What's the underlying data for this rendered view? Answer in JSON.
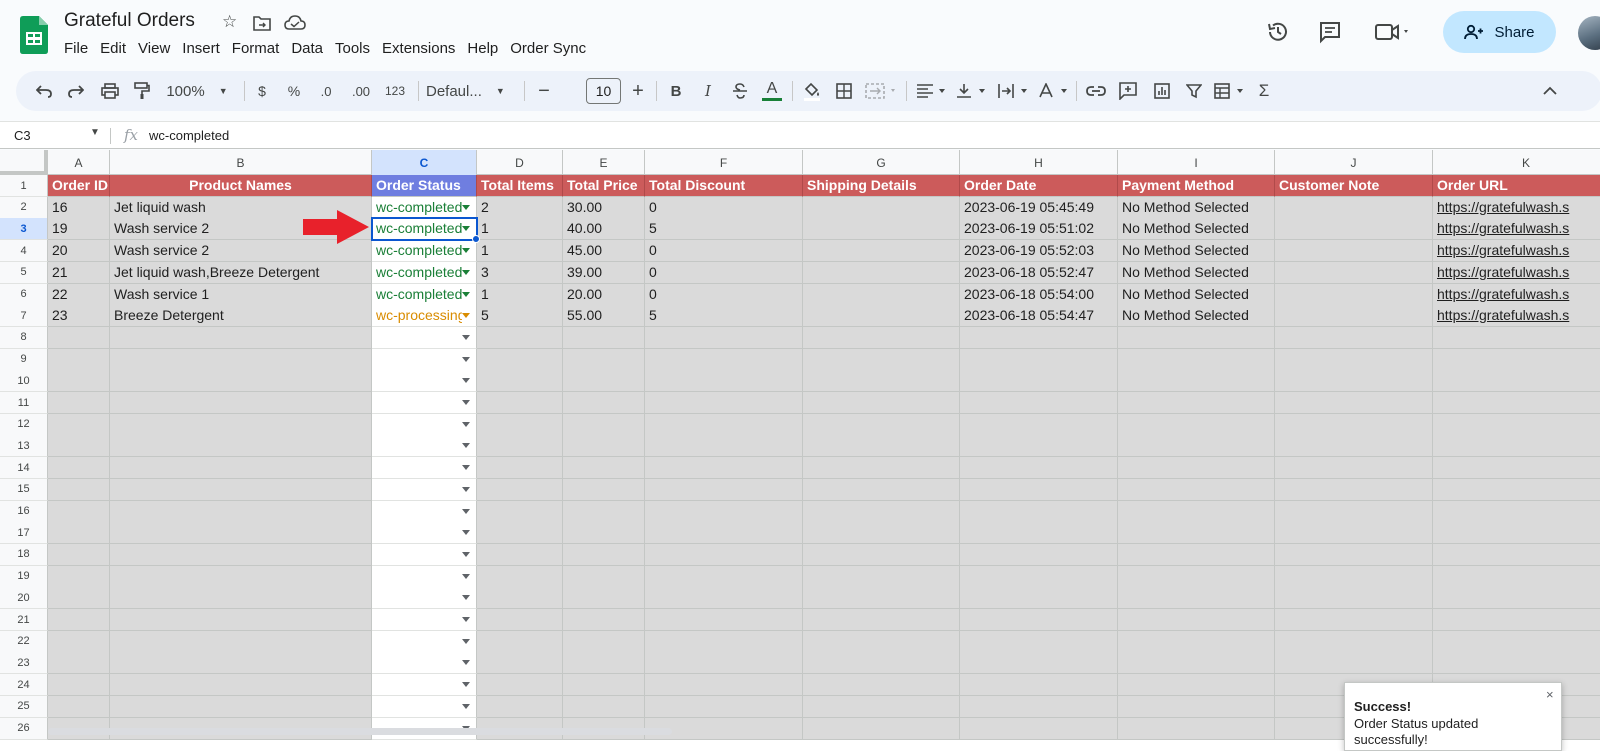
{
  "app": {
    "doc_title": "Grateful Orders",
    "menu": [
      "File",
      "Edit",
      "View",
      "Insert",
      "Format",
      "Data",
      "Tools",
      "Extensions",
      "Help",
      "Order Sync"
    ],
    "share_label": "Share"
  },
  "toolbar": {
    "zoom": "100%",
    "currency": "$",
    "percent": "%",
    "decrease_decimal": ".0",
    "increase_decimal": ".00",
    "number_format": "123",
    "font": "Defaul...",
    "font_size": "10",
    "bold": "B",
    "italic": "I",
    "text_color": "A",
    "function": "Σ"
  },
  "formula_bar": {
    "cell_ref": "C3",
    "fx": "fx",
    "value": "wc-completed"
  },
  "sheet": {
    "columns": [
      "A",
      "B",
      "C",
      "D",
      "E",
      "F",
      "G",
      "H",
      "I",
      "J",
      "K"
    ],
    "header_row": [
      "Order ID",
      "Product Names",
      "Order Status",
      "Total Items",
      "Total Price",
      "Total Discount",
      "Shipping Details",
      "Order Date",
      "Payment Method",
      "Customer Note",
      "Order URL"
    ],
    "rows": [
      {
        "id": "16",
        "product": "Jet liquid wash",
        "status": "wc-completed",
        "items": "2",
        "price": "30.00",
        "discount": "0",
        "shipping": "",
        "date": "2023-06-19 05:45:49",
        "payment": "No Method Selected",
        "note": "",
        "url": "https://gratefulwash.s"
      },
      {
        "id": "19",
        "product": "Wash service 2",
        "status": "wc-completed",
        "items": "1",
        "price": "40.00",
        "discount": "5",
        "shipping": "",
        "date": "2023-06-19 05:51:02",
        "payment": "No Method Selected",
        "note": "",
        "url": "https://gratefulwash.s"
      },
      {
        "id": "20",
        "product": "Wash service 2",
        "status": "wc-completed",
        "items": "1",
        "price": "45.00",
        "discount": "0",
        "shipping": "",
        "date": "2023-06-19 05:52:03",
        "payment": "No Method Selected",
        "note": "",
        "url": "https://gratefulwash.s"
      },
      {
        "id": "21",
        "product": "Jet liquid wash,Breeze Detergent",
        "status": "wc-completed",
        "items": "3",
        "price": "39.00",
        "discount": "0",
        "shipping": "",
        "date": "2023-06-18 05:52:47",
        "payment": "No Method Selected",
        "note": "",
        "url": "https://gratefulwash.s"
      },
      {
        "id": "22",
        "product": "Wash service 1",
        "status": "wc-completed",
        "items": "1",
        "price": "20.00",
        "discount": "0",
        "shipping": "",
        "date": "2023-06-18 05:54:00",
        "payment": "No Method Selected",
        "note": "",
        "url": "https://gratefulwash.s"
      },
      {
        "id": "23",
        "product": "Breeze Detergent",
        "status": "wc-processing",
        "items": "5",
        "price": "55.00",
        "discount": "5",
        "shipping": "",
        "date": "2023-06-18 05:54:47",
        "payment": "No Method Selected",
        "note": "",
        "url": "https://gratefulwash.s"
      }
    ],
    "row_numbers": [
      "1",
      "2",
      "3",
      "4",
      "5",
      "6",
      "7",
      "8",
      "9",
      "10",
      "11",
      "12",
      "13",
      "14",
      "15",
      "16",
      "17",
      "18",
      "19",
      "20",
      "21",
      "22",
      "23",
      "24",
      "25",
      "26"
    ],
    "selected_cell": "C3"
  },
  "toast": {
    "title": "Success!",
    "message": "Order Status updated successfully!",
    "close": "×"
  },
  "colors": {
    "header_red": "#cc5b5b",
    "header_status_blue": "#6f7ee0",
    "completed_green": "#1a7f37",
    "processing_orange": "#d98c00",
    "selection_blue": "#0b57d0",
    "share_bg": "#c2e7ff"
  }
}
